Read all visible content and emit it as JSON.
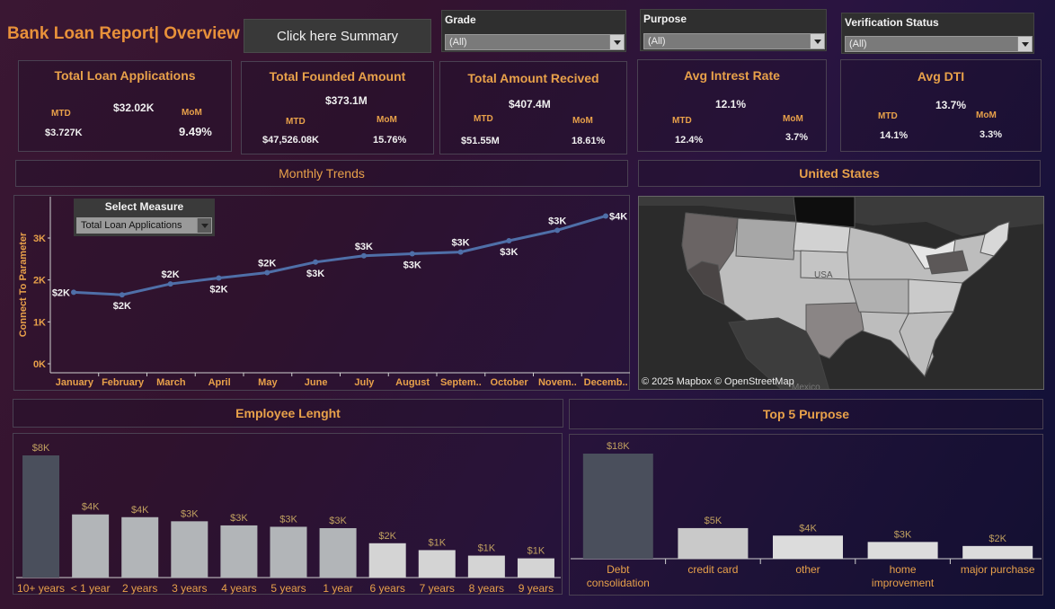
{
  "header": {
    "title": "Bank Loan Report| Overview",
    "summary_button": "Click here Summary"
  },
  "filters": [
    {
      "label": "Grade",
      "value": "(All)"
    },
    {
      "label": "Purpose",
      "value": "(All)"
    },
    {
      "label": "Verification Status",
      "value": "(All)"
    }
  ],
  "kpis": {
    "applications": {
      "title": "Total Loan Applications",
      "total": "$32.02K",
      "mtd_label": "MTD",
      "mtd": "$3.727K",
      "mom_label": "MoM",
      "mom": "9.49%"
    },
    "funded": {
      "title": "Total Founded Amount",
      "total": "$373.1M",
      "mtd_label": "MTD",
      "mtd": "$47,526.08K",
      "mom_label": "MoM",
      "mom": "15.76%"
    },
    "received": {
      "title": "Total Amount Recived",
      "total": "$407.4M",
      "mtd_label": "MTD",
      "mtd": "$51.55M",
      "mom_label": "MoM",
      "mom": "18.61%"
    },
    "interest": {
      "title": "Avg Intrest Rate",
      "total": "12.1%",
      "mtd_label": "MTD",
      "mtd": "12.4%",
      "mom_label": "MoM",
      "mom": "3.7%"
    },
    "dti": {
      "title": "Avg DTI",
      "total": "13.7%",
      "mtd_label": "MTD",
      "mtd": "14.1%",
      "mom_label": "MoM",
      "mom": "3.3%"
    }
  },
  "sections": {
    "monthly": "Monthly Trends",
    "map": "United States",
    "employee": "Employee Lenght",
    "purpose": "Top 5 Purpose"
  },
  "measure_selector": {
    "label": "Select Measure",
    "value": "Total Loan Applications"
  },
  "map": {
    "credit": "© 2025 Mapbox © OpenStreetMap",
    "label_usa": "USA",
    "label_mexico": "Mexico"
  },
  "colors": {
    "accent": "#e8913a",
    "line": "#4f6fa8",
    "bar_dark": "#4a4f5c",
    "bar_light": "#b5b8bb"
  },
  "chart_data": [
    {
      "type": "line",
      "ylabel": "Connect To Parameter",
      "ylim": [
        0,
        4200
      ],
      "yticks": [
        "0K",
        "1K",
        "2K",
        "3K"
      ],
      "ytick_values": [
        0,
        1000,
        2000,
        3000
      ],
      "categories": [
        "January",
        "February",
        "March",
        "April",
        "May",
        "June",
        "July",
        "August",
        "Septem..",
        "October",
        "Novem..",
        "Decemb.."
      ],
      "values": [
        1920,
        1860,
        2120,
        2260,
        2390,
        2640,
        2790,
        2840,
        2880,
        3150,
        3400,
        3740
      ],
      "labels": [
        "$2K",
        "$2K",
        "$2K",
        "$2K",
        "$2K",
        "$3K",
        "$3K",
        "$3K",
        "$3K",
        "$3K",
        "$3K",
        "$4K"
      ]
    },
    {
      "type": "bar",
      "categories": [
        "10+ years",
        "< 1 year",
        "2 years",
        "3 years",
        "4 years",
        "5 years",
        "1 year",
        "6 years",
        "7 years",
        "8 years",
        "9 years"
      ],
      "values": [
        8900,
        4600,
        4400,
        4100,
        3800,
        3700,
        3600,
        2500,
        2000,
        1600,
        1400
      ],
      "labels": [
        "$8K",
        "$4K",
        "$4K",
        "$3K",
        "$3K",
        "$3K",
        "$3K",
        "$2K",
        "$1K",
        "$1K",
        "$1K"
      ]
    },
    {
      "type": "bar",
      "categories": [
        "Debt consolidation",
        "credit card",
        "other",
        "home improvement",
        "major purchase"
      ],
      "values": [
        18200,
        5300,
        4000,
        2900,
        2200
      ],
      "labels": [
        "$18K",
        "$5K",
        "$4K",
        "$3K",
        "$2K"
      ]
    }
  ]
}
